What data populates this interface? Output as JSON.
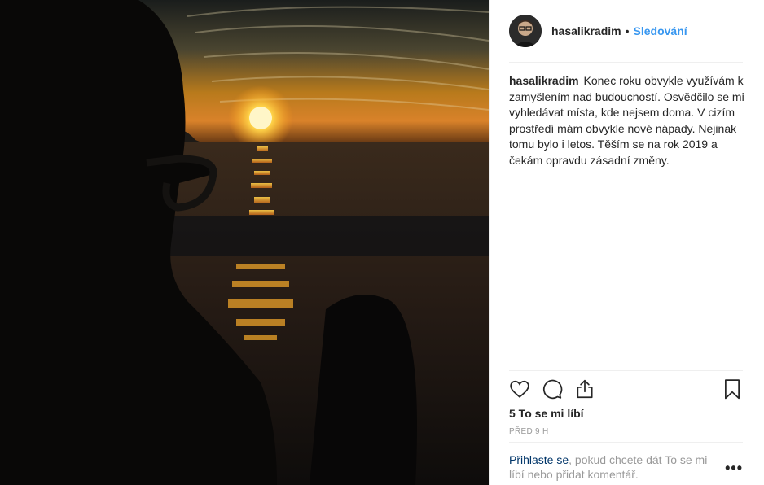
{
  "post": {
    "username": "hasalikradim",
    "separator": "•",
    "follow_label": "Sledování",
    "caption_user": "hasalikradim",
    "caption_text": "Konec roku obvykle využívám k zamyšlením nad budoucností. Osvědčilo se mi vyhledávat místa, kde nejsem doma. V cizím prostředí mám obvykle nové nápady. Nejinak tomu bylo i letos. Těším se na rok 2019 a čekám opravdu zásadní změny.",
    "likes": "5 To se mi líbí",
    "time": "PŘED 9 H",
    "login_link": "Přihlaste se",
    "login_text": ", pokud chcete dát To se mi líbí nebo přidat komentář.",
    "more_label": "•••"
  },
  "icons": {
    "like": "heart-icon",
    "comment": "comment-icon",
    "share": "share-icon",
    "save": "bookmark-icon"
  },
  "colors": {
    "link": "#3897f0",
    "login_link": "#003569",
    "muted": "#999999"
  }
}
